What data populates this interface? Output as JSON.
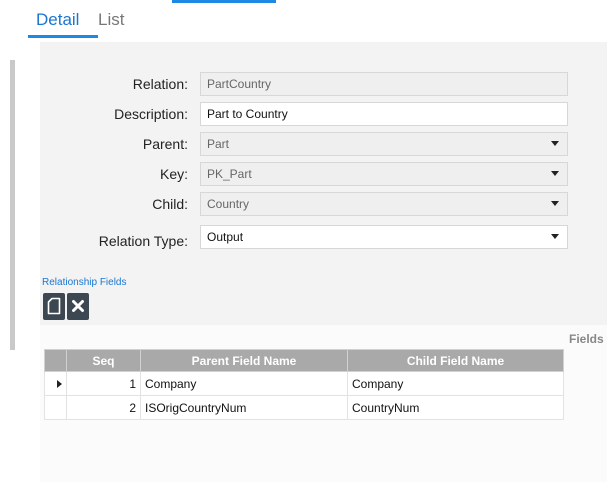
{
  "tabs": [
    {
      "label": "Detail"
    },
    {
      "label": "List"
    }
  ],
  "form": {
    "relation": {
      "label": "Relation:",
      "value": "PartCountry"
    },
    "description": {
      "label": "Description:",
      "value": "Part to Country"
    },
    "parent": {
      "label": "Parent:",
      "value": "Part"
    },
    "key": {
      "label": "Key:",
      "value": "PK_Part"
    },
    "child": {
      "label": "Child:",
      "value": "Country"
    },
    "relation_type": {
      "label": "Relation Type:",
      "value": "Output"
    }
  },
  "relationship_fields": {
    "label": "Relationship Fields"
  },
  "toolbar": {
    "new_icon": "new-document-icon",
    "delete_icon": "delete-x-icon"
  },
  "grid": {
    "side_label": "Fields",
    "headers": {
      "seq": "Seq",
      "parent": "Parent Field Name",
      "child": "Child Field Name"
    },
    "rows": [
      {
        "seq": "1",
        "parent": "Company",
        "child": "Company"
      },
      {
        "seq": "2",
        "parent": "ISOrigCountryNum",
        "child": "CountryNum"
      }
    ]
  },
  "colors": {
    "accent": "#1e88e5",
    "header_bg": "#a9a9a9",
    "button_bg": "#3d4752"
  }
}
